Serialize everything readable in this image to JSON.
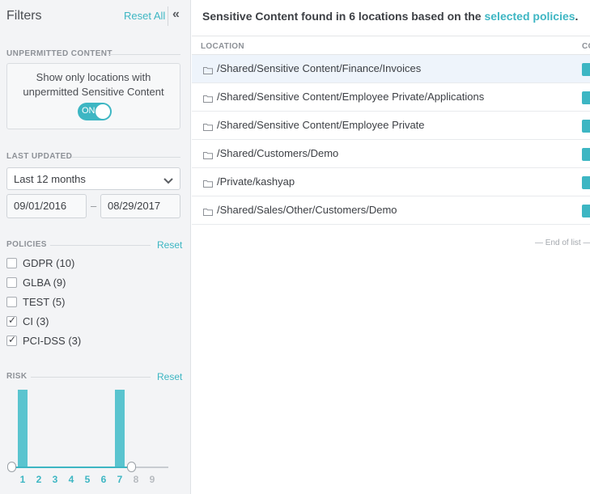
{
  "sidebar": {
    "title": "Filters",
    "reset_all": "Reset All",
    "collapse_glyph": "«",
    "unpermitted": {
      "label": "UNPERMITTED CONTENT",
      "description": "Show only locations with unpermitted Sensitive Content",
      "toggle_label": "ON",
      "toggle_on": true
    },
    "last_updated": {
      "label": "LAST UPDATED",
      "selected": "Last 12 months",
      "from": "09/01/2016",
      "separator": "–",
      "to": "08/29/2017"
    },
    "policies": {
      "label": "POLICIES",
      "reset": "Reset",
      "items": [
        {
          "label": "GDPR (10)",
          "checked": false
        },
        {
          "label": "GLBA (9)",
          "checked": false
        },
        {
          "label": "TEST (5)",
          "checked": false
        },
        {
          "label": "CI (3)",
          "checked": true
        },
        {
          "label": "PCI-DSS (3)",
          "checked": true
        }
      ]
    },
    "risk": {
      "label": "RISK",
      "reset": "Reset",
      "levels": [
        "1",
        "2",
        "3",
        "4",
        "5",
        "6",
        "7",
        "8",
        "9"
      ],
      "counts": [
        3,
        0,
        0,
        0,
        0,
        0,
        3,
        0,
        0
      ],
      "selected_range": [
        1,
        7
      ]
    }
  },
  "main": {
    "title_prefix": "Sensitive Content found in 6 locations based on the ",
    "title_link": "selected policies",
    "title_suffix": ".",
    "columns": [
      "LOCATION",
      "CO"
    ],
    "rows": [
      {
        "path": "/Shared/Sensitive Content/Finance/Invoices",
        "selected": true
      },
      {
        "path": "/Shared/Sensitive Content/Employee Private/Applications",
        "selected": false
      },
      {
        "path": "/Shared/Sensitive Content/Employee Private",
        "selected": false
      },
      {
        "path": "/Shared/Customers/Demo",
        "selected": false
      },
      {
        "path": "/Private/kashyap",
        "selected": false
      },
      {
        "path": "/Shared/Sales/Other/Customers/Demo",
        "selected": false
      }
    ],
    "end_of_list": "— End of list —"
  },
  "colors": {
    "accent": "#3db6c3",
    "bar": "#5ac4cf",
    "sidebar_bg": "#f3f4f6",
    "selected_row": "#eef4fb"
  },
  "icons": {
    "collapse": "double-chevron-left-icon",
    "select": "chevron-down-icon",
    "location": "folder-icon",
    "check": "checkmark-icon"
  }
}
